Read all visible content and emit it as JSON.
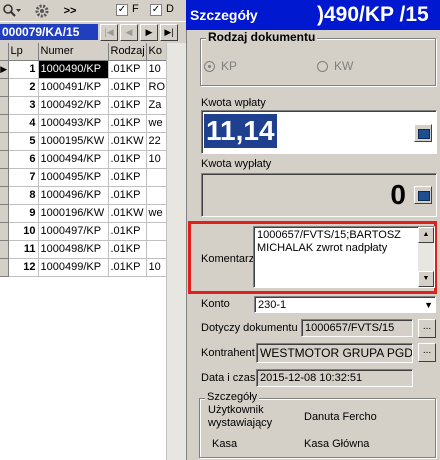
{
  "toolbar": {
    "icons": [
      "search-dropdown-icon",
      "gear-icon",
      "double-chevron-icon"
    ],
    "more_label": ">>",
    "filter_f_label": "F",
    "filter_d_label": "D"
  },
  "navigator": {
    "record_id": "000079/KA/15",
    "first": "|◀",
    "prev": "◀",
    "next": "▶",
    "last": "▶|"
  },
  "grid": {
    "columns": [
      "Lp",
      "Numer",
      "Rodzaj",
      "Ko"
    ],
    "rows": [
      {
        "lp": "1",
        "numer": "1000490/KP",
        "rodzaj": ".01KP",
        "ko": "10"
      },
      {
        "lp": "2",
        "numer": "1000491/KP",
        "rodzaj": ".01KP",
        "ko": "RO"
      },
      {
        "lp": "3",
        "numer": "1000492/KP",
        "rodzaj": ".01KP",
        "ko": "Za"
      },
      {
        "lp": "4",
        "numer": "1000493/KP",
        "rodzaj": ".01KP",
        "ko": "we"
      },
      {
        "lp": "5",
        "numer": "1000195/KW",
        "rodzaj": ".01KW",
        "ko": "22"
      },
      {
        "lp": "6",
        "numer": "1000494/KP",
        "rodzaj": ".01KP",
        "ko": "10"
      },
      {
        "lp": "7",
        "numer": "1000495/KP",
        "rodzaj": ".01KP",
        "ko": ""
      },
      {
        "lp": "8",
        "numer": "1000496/KP",
        "rodzaj": ".01KP",
        "ko": ""
      },
      {
        "lp": "9",
        "numer": "1000196/KW",
        "rodzaj": ".01KW",
        "ko": "we"
      },
      {
        "lp": "10",
        "numer": "1000497/KP",
        "rodzaj": ".01KP",
        "ko": ""
      },
      {
        "lp": "11",
        "numer": "1000498/KP",
        "rodzaj": ".01KP",
        "ko": ""
      },
      {
        "lp": "12",
        "numer": "1000499/KP",
        "rodzaj": ".01KP",
        "ko": "10"
      }
    ]
  },
  "details": {
    "title": "Szczegóły",
    "doc_number": ")490/KP /15",
    "rodzaj_group": "Rodzaj dokumentu",
    "radio_kp": "KP",
    "radio_kw": "KW",
    "kwota_wplaty_label": "Kwota wpłaty",
    "kwota_wplaty_value": "11,14",
    "kwota_wyplaty_label": "Kwota wypłaty",
    "kwota_wyplaty_value": "0",
    "komentarz_label": "Komentarz",
    "komentarz_value": "1000657/FVTS/15;BARTOSZ MICHALAK zwrot nadpłaty",
    "konto_label": "Konto",
    "konto_value": "230-1",
    "dotyczy_label": "Dotyczy dokumentu",
    "dotyczy_value": "1000657/FVTS/15",
    "kontrahent_label": "Kontrahent",
    "kontrahent_value": "WESTMOTOR GRUPA PGD S",
    "data_label": "Data i czas",
    "data_value": "2015-12-08 10:32:51",
    "szczegoly_group": "Szczegóły",
    "uzytkownik_label": "Użytkownik wystawiający",
    "uzytkownik_value": "Danuta Fercho",
    "kasa_label": "Kasa",
    "kasa_value": "Kasa Główna",
    "dots": "..."
  },
  "colors": {
    "title_bg": "#0018d0",
    "highlight_box": "#e0201c",
    "selected_amount_bg": "#1f3f8f",
    "record_field_bg": "#1f3fbf"
  }
}
